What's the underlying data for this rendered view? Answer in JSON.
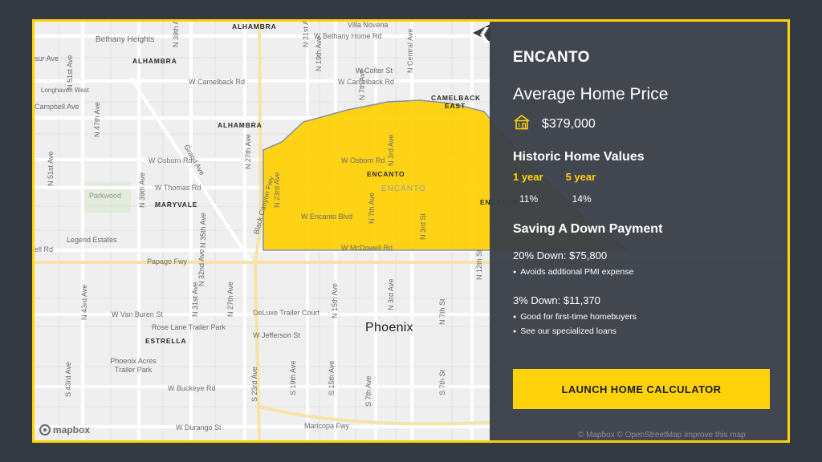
{
  "map": {
    "labels": {
      "alhambra_top": "ALHAMBRA",
      "villa_novena": "Villa Novena",
      "bethany_heights": "Bethany Heights",
      "n39th": "N 39th Ave",
      "n21st": "N 21st Ave",
      "w_bethany": "W Bethany Home Rd",
      "n19th": "N 19th Ave",
      "n_central": "N Central Ave",
      "n51st_top": "N 51st Ave",
      "sur_ave": "sur Ave",
      "alhambra_mid": "ALHAMBRA",
      "w_colter": "W Colter St",
      "n7th_top": "N 7th Ave",
      "longhaven": "Longhaven West",
      "w_camelback_left": "W Camelback Rd",
      "w_camelback_right": "W Camelback Rd",
      "camelback_east": "CAMELBACK EAST",
      "campbell": "Campbell Ave",
      "n47th": "N 47th Ave",
      "alhambra_low": "ALHAMBRA",
      "grand_ave": "Grand Ave",
      "n27th_top": "N 27th Ave",
      "n51st_low": "N 51st Ave",
      "w_osborn_left": "W Osborn Rd",
      "w_osborn_in": "W Osborn Rd",
      "n3rd_in": "N 3rd Ave",
      "encanto_bold": "ENCANTO",
      "encanto_park": "ENCANTO",
      "n23rd": "N 23rd Ave",
      "parkwood": "Parkwood",
      "n39th_low": "N 39th Ave",
      "w_thomas": "W Thomas Rd",
      "maryvale": "MARYVALE",
      "black_canyon": "Black Canyon Fwy",
      "w_encanto": "W Encanto Blvd",
      "n7th_in": "N 7th Ave",
      "n3rd_st": "N 3rd St",
      "enc_edge": "ENCANTO",
      "legend_estates": "Legend Estates",
      "n35th": "N 35th Ave",
      "n32nd": "N 32nd Ave",
      "w_mcdowell": "W McDowell Rd",
      "ell_rd": "ell Rd",
      "papago": "Papago Fwy",
      "n31st": "N 31st Ave",
      "n27th_low": "N 27th Ave",
      "n15th": "N 15th Ave",
      "n3rd_low": "N 3rd Ave",
      "n7th_st": "N 7th St",
      "n12th": "N 12th St",
      "n43rd": "N 43rd Ave",
      "w_van_buren": "W Van Buren St",
      "deluxe": "DeLuxe Trailer Court",
      "rose_lane": "Rose Lane Trailer Park",
      "w_jefferson": "W Jefferson St",
      "phoenix": "Phoenix",
      "estrella": "ESTRELLA",
      "phoenix_acres": "Phoenix Acres Trailer Park",
      "s43rd": "S 43rd Ave",
      "s23rd": "S 23rd Ave",
      "s19th": "S 19th Ave",
      "s15th": "S 15th Ave",
      "s7th_ave": "S 7th Ave",
      "s7th_st": "S 7th St",
      "w_buckeye": "W Buckeye Rd",
      "w_durango": "W Durango St",
      "maricopa": "Maricopa Fwy"
    },
    "colors": {
      "neighborhood_fill": "#ffd20a",
      "neighborhood_stroke": "#7a8aa8",
      "road": "#ffffff",
      "minor_road": "#e3e3e3",
      "highway": "#f4dc94",
      "park": "#dfe8d6"
    },
    "mapbox_logo": "mapbox",
    "attribution": "© Mapbox © OpenStreetMap  Improve this map"
  },
  "panel": {
    "collapse_icon": "chevron-left-icon",
    "neighborhood": "ENCANTO",
    "avg_price_heading": "Average Home Price",
    "price_icon": "house-icon",
    "avg_price": "$379,000",
    "historic_heading": "Historic Home Values",
    "historic": [
      {
        "label": "1 year",
        "value": "11%"
      },
      {
        "label": "5 year",
        "value": "14%"
      }
    ],
    "saving_heading": "Saving A Down Payment",
    "down20": "20% Down: $75,800",
    "down20_bullets": [
      "Avoids addtional PMI expense"
    ],
    "down3": "3% Down: $11,370",
    "down3_bullets": [
      "Good for first-time homebuyers",
      "See our specialized loans"
    ],
    "cta": "LAUNCH HOME CALCULATOR",
    "accent": "#ffd20a",
    "panel_bg": "#3a3e48"
  }
}
